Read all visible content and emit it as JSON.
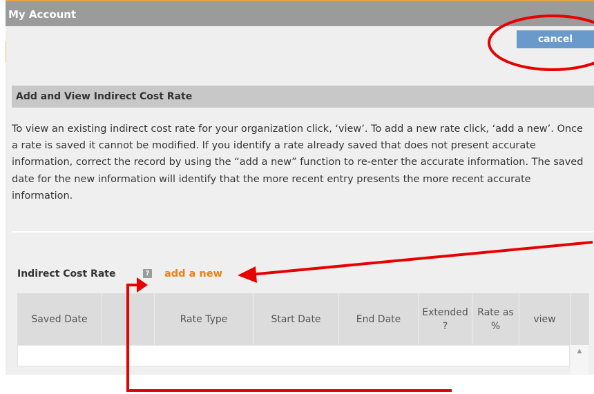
{
  "window": {
    "title": "My Account"
  },
  "toolbar": {
    "cancel_label": "cancel"
  },
  "section": {
    "title": "Add and View Indirect Cost Rate"
  },
  "description": "To view an existing indirect cost rate for your organization click, ‘view’. To add a new rate click, ‘add a new’. Once a rate is saved it cannot be modified. If you identify a rate already saved that does not present accurate information, correct the record by using the “add a new” function to re-enter the accurate information. The saved date for the new information will identify that the more recent entry presents the more recent accurate information.",
  "rates": {
    "label": "Indirect Cost Rate",
    "help_icon": "?",
    "add_new_label": "add a new",
    "columns": [
      "Saved Date",
      "",
      "Rate Type",
      "Start Date",
      "End Date",
      "Extended ?",
      "Rate as %",
      "view"
    ]
  },
  "colors": {
    "accent": "#f07f12",
    "button": "#6a9acb",
    "annotation": "#e60000"
  },
  "icons": {
    "help": "question-mark-icon",
    "scroll_up": "chevron-up-icon"
  }
}
